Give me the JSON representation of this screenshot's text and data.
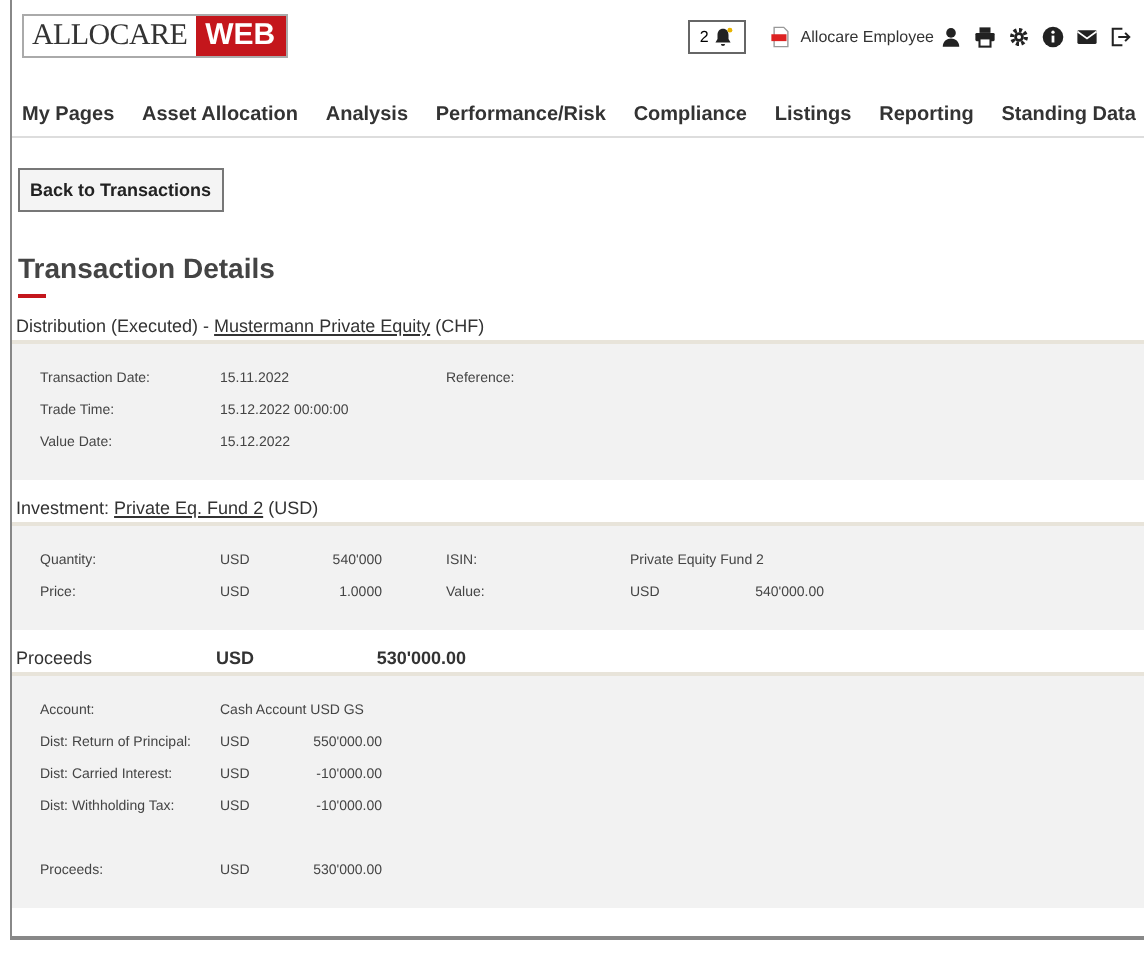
{
  "header": {
    "logo": {
      "brand": "ALLOCARE",
      "suffix": "WEB"
    },
    "notifications": "2",
    "user": "Allocare Employee"
  },
  "nav": [
    {
      "label": "My Pages"
    },
    {
      "label": "Asset Allocation"
    },
    {
      "label": "Analysis"
    },
    {
      "label": "Performance/Risk"
    },
    {
      "label": "Compliance"
    },
    {
      "label": "Listings"
    },
    {
      "label": "Reporting"
    },
    {
      "label": "Standing Data"
    }
  ],
  "back_button": "Back to Transactions",
  "title": "Transaction Details",
  "sections": [
    {
      "heading": {
        "prefix": "Distribution (Executed) - ",
        "link": "Mustermann Private Equity",
        "suffix": " (CHF)"
      },
      "rows": [
        {
          "kind": "field",
          "label": "Transaction Date:",
          "value": "15.11.2022",
          "label_2": "Reference:"
        },
        {
          "kind": "field",
          "label": "Trade Time:",
          "value": "15.12.2022  00:00:00"
        },
        {
          "kind": "field",
          "label": "Value Date:",
          "value": "15.12.2022"
        }
      ]
    },
    {
      "heading": {
        "prefix": "Investment: ",
        "link": "Private Eq. Fund 2",
        "suffix": " (USD)"
      },
      "rows": [
        {
          "kind": "field",
          "label": "Quantity:",
          "currency": "USD",
          "amount": "540'000",
          "label_2": "ISIN:",
          "value_2": "Private Equity Fund 2"
        },
        {
          "kind": "field",
          "label": "Price:",
          "currency": "USD",
          "amount": "1.0000",
          "label_2": "Value:",
          "currency_2": "USD",
          "amount_2": "540'000.00"
        }
      ]
    },
    {
      "heading": {
        "prefix": "Proceeds",
        "currency": "USD",
        "amount": "530'000.00"
      },
      "rows": [
        {
          "kind": "field",
          "label": "Account:",
          "value": "Cash Account USD GS"
        },
        {
          "kind": "field",
          "label": "Dist: Return of Principal:",
          "currency": "USD",
          "amount": "550'000.00"
        },
        {
          "kind": "field",
          "label": "Dist: Carried Interest:",
          "currency": "USD",
          "amount": "-10'000.00"
        },
        {
          "kind": "field",
          "label": "Dist: Withholding Tax:",
          "currency": "USD",
          "amount": "-10'000.00"
        },
        {
          "kind": "total",
          "label": "Proceeds:",
          "currency": "USD",
          "amount": "530'000.00"
        }
      ]
    }
  ]
}
